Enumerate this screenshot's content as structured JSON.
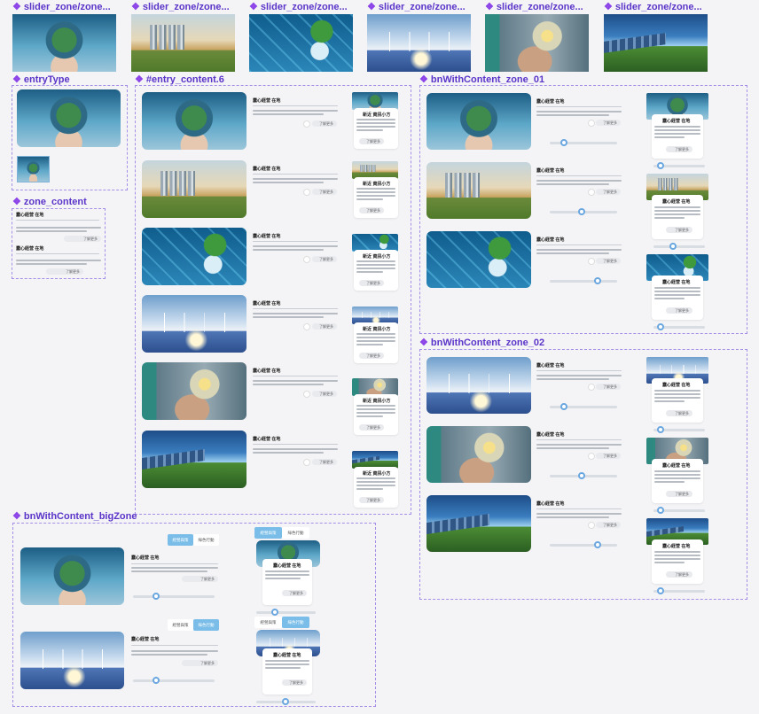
{
  "frames": {
    "slider_1": "slider_zone/zone...",
    "slider_2": "slider_zone/zone...",
    "slider_3": "slider_zone/zone...",
    "slider_4": "slider_zone/zone...",
    "slider_5": "slider_zone/zone...",
    "slider_6": "slider_zone/zone...",
    "entryType": "entryType",
    "entry_content": "#entry_content.6",
    "bn01": "bnWithContent_zone_01",
    "zone_content": "zone_content",
    "bn02": "bnWithContent_zone_02",
    "bigzone": "bnWithContent_bigZone"
  },
  "content": {
    "title": "蠢心経营 在地",
    "card_title": "新近 資訊小方",
    "card_title_b": "蠢心経营 在地",
    "more": "了解更多",
    "tab_1": "經營與策",
    "tab_2": "綠色行動"
  },
  "colors": {
    "frame_label": "#5b34c9",
    "frame_border": "#a48ee6",
    "accent": "#79bde8"
  }
}
